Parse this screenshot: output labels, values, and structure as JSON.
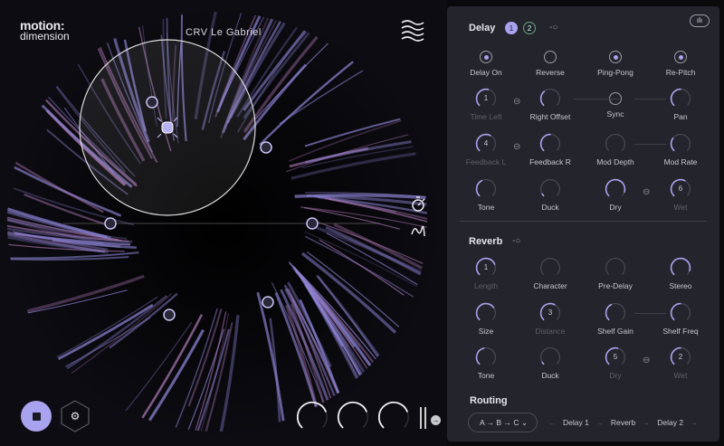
{
  "app": {
    "logo_top": "motion:",
    "logo_bottom": "dimension",
    "preset_title": "CRV Le Gabriel"
  },
  "colors": {
    "accent": "#a9a3ef",
    "panel": "#24252c",
    "background": "#0a0a0d"
  },
  "delay": {
    "title": "Delay",
    "tabs": [
      "1",
      "2"
    ],
    "toggles": [
      {
        "label": "Delay On",
        "on": true
      },
      {
        "label": "Reverse",
        "on": false
      },
      {
        "label": "Ping-Pong",
        "on": true
      },
      {
        "label": "Re-Pitch",
        "on": true
      }
    ],
    "knobs": [
      [
        {
          "label": "Time Left",
          "value": 0.55,
          "num": "1",
          "dim": true
        },
        {
          "label": "Right Offset",
          "value": 0.35
        },
        {
          "label": "Sync",
          "type": "toggle"
        },
        {
          "label": "Pan",
          "value": 0.5
        }
      ],
      [
        {
          "label": "Feedback L",
          "value": 0.6,
          "num": "4",
          "dim": true
        },
        {
          "label": "Feedback R",
          "value": 0.5
        },
        {
          "label": "Mod Depth",
          "value": 0.0
        },
        {
          "label": "Mod Rate",
          "value": 0.3
        }
      ],
      [
        {
          "label": "Tone",
          "value": 0.4
        },
        {
          "label": "Duck",
          "value": 0.05
        },
        {
          "label": "Dry",
          "value": 0.9
        },
        {
          "label": "Wet",
          "value": 0.6,
          "num": "6",
          "dim": true
        }
      ]
    ]
  },
  "reverb": {
    "title": "Reverb",
    "knobs": [
      [
        {
          "label": "Length",
          "value": 0.75,
          "num": "1",
          "dim": true
        },
        {
          "label": "Character",
          "value": 0.0
        },
        {
          "label": "Pre-Delay",
          "value": 0.0
        },
        {
          "label": "Stereo",
          "value": 0.9
        }
      ],
      [
        {
          "label": "Size",
          "value": 0.7
        },
        {
          "label": "Distance",
          "value": 0.6,
          "num": "3",
          "dim": true
        },
        {
          "label": "Shelf Gain",
          "value": 0.4
        },
        {
          "label": "Shelf Freq",
          "value": 0.5
        }
      ],
      [
        {
          "label": "Tone",
          "value": 0.45
        },
        {
          "label": "Duck",
          "value": 0.05
        },
        {
          "label": "Dry",
          "value": 0.55,
          "num": "5",
          "dim": true
        },
        {
          "label": "Wet",
          "value": 0.5,
          "num": "2",
          "dim": true
        }
      ]
    ]
  },
  "routing": {
    "title": "Routing",
    "select": "A → B → C",
    "chain": [
      "Delay 1",
      "Reverb",
      "Delay 2"
    ]
  },
  "macros": {
    "values": [
      0.75,
      0.75,
      0.75
    ]
  }
}
